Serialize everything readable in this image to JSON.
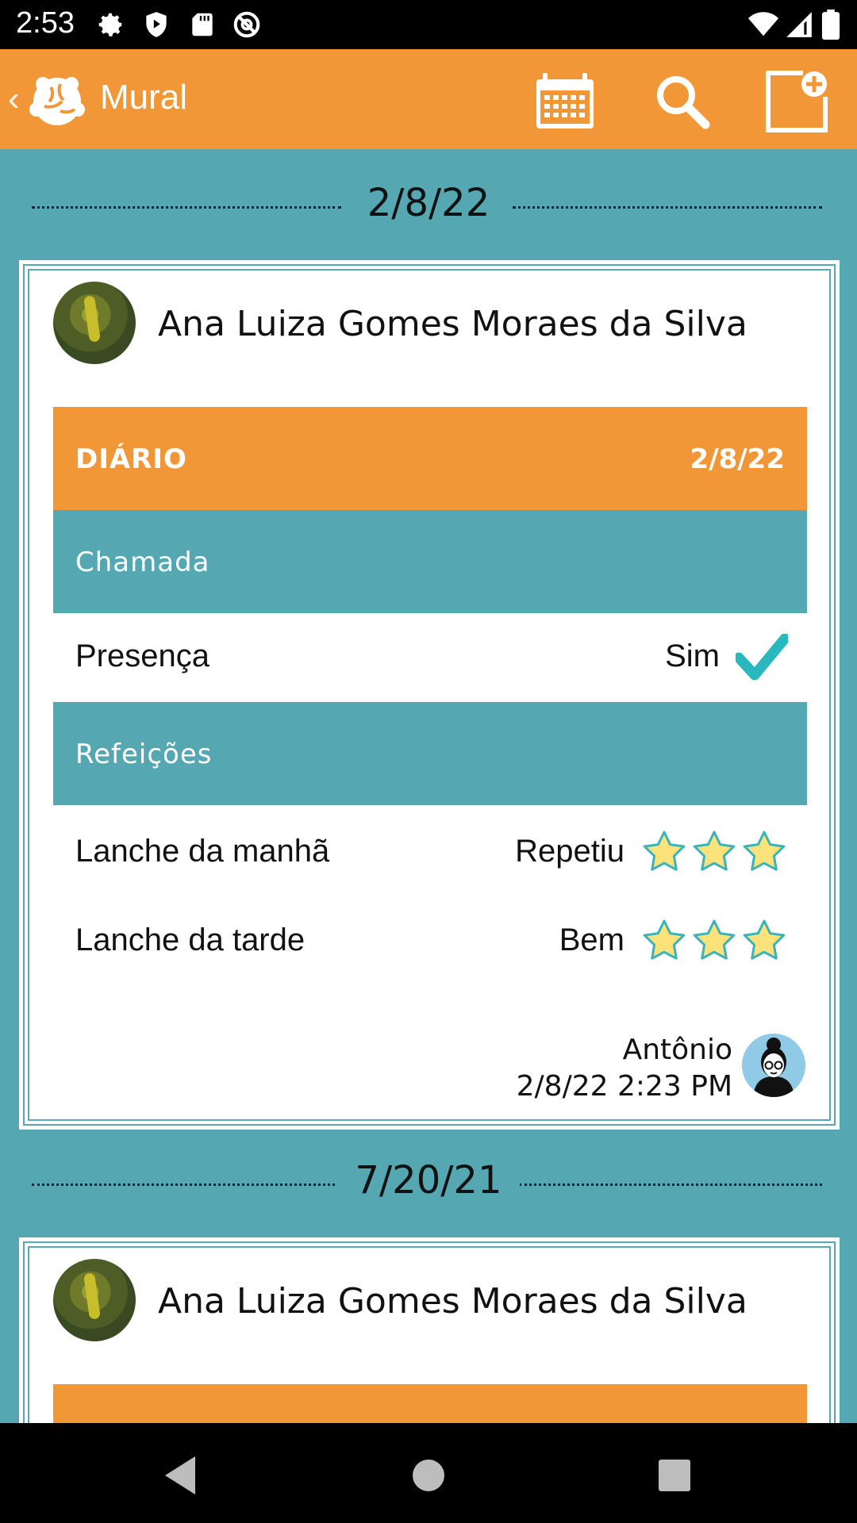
{
  "status_bar": {
    "time": "2:53",
    "icons": [
      "settings-icon",
      "play-protect-icon",
      "sd-card-icon",
      "sync-disabled-icon",
      "wifi-icon",
      "signal-icon",
      "battery-icon"
    ]
  },
  "app_bar": {
    "title": "Mural",
    "back_glyph": "‹",
    "actions": [
      "calendar-icon",
      "search-icon",
      "new-post-icon"
    ]
  },
  "feed": [
    {
      "date": "2/8/22",
      "student": "Ana Luiza Gomes Moraes da Silva",
      "header": {
        "label": "DIÁRIO",
        "date": "2/8/22"
      },
      "sections": [
        {
          "title": "Chamada",
          "rows": [
            {
              "label": "Presença",
              "value": "Sim",
              "indicator": "check"
            }
          ]
        },
        {
          "title": "Refeições",
          "rows": [
            {
              "label": "Lanche da manhã",
              "value": "Repetiu",
              "stars": 3
            },
            {
              "label": "Lanche da tarde",
              "value": "Bem",
              "stars": 3
            }
          ]
        }
      ],
      "author": {
        "name": "Antônio",
        "datetime": "2/8/22 2:23 PM"
      }
    },
    {
      "date": "7/20/21",
      "student": "Ana Luiza Gomes Moraes da Silva"
    }
  ],
  "colors": {
    "background": "#55a8b1",
    "accent": "#f29737",
    "teal": "#55a8b1",
    "check": "#28b8bd",
    "star": "#fbe27a"
  }
}
